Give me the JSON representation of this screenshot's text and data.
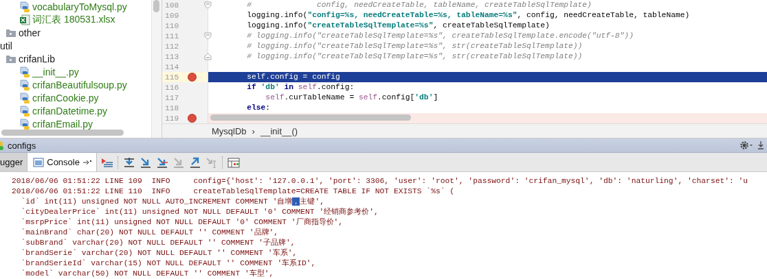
{
  "project_tree": {
    "items": [
      {
        "children": [
          {
            "children": [
              {
                "label": "vocabularyToMysql.py",
                "kind": "python"
              },
              {
                "label": "词汇表 180531.xlsx",
                "kind": "excel"
              }
            ]
          },
          {
            "label": "other",
            "kind": "folder"
          }
        ]
      },
      {
        "label": "util",
        "children": [
          {
            "label": "crifanLib",
            "kind": "folder",
            "children": [
              {
                "label": "__init__.py",
                "kind": "python"
              },
              {
                "label": "crifanBeautifulsoup.py",
                "kind": "python"
              },
              {
                "label": "crifanCookie.py",
                "kind": "python"
              },
              {
                "label": "crifanDatetime.py",
                "kind": "python"
              },
              {
                "label": "crifanEmail.py",
                "kind": "python"
              }
            ]
          }
        ]
      }
    ]
  },
  "editor": {
    "lines": [
      {
        "number": "108",
        "breakpoint": false,
        "current": false,
        "fold_start": true,
        "fold_end": false,
        "tokens": [
          {
            "text": "        #              config, needCreateTable, tableName, createTableSqlTemplate)",
            "kind": "comment"
          }
        ]
      },
      {
        "number": "109",
        "breakpoint": false,
        "current": false,
        "fold_start": false,
        "fold_end": false,
        "tokens": [
          {
            "text": "        logging.info(",
            "kind": "plain"
          },
          {
            "text": "\"config=%s, needCreateTable=%s, tableName=%s\"",
            "kind": "string"
          },
          {
            "text": ", config, needCreateTable, tableName)",
            "kind": "plain"
          }
        ]
      },
      {
        "number": "110",
        "breakpoint": false,
        "current": false,
        "fold_start": false,
        "fold_end": false,
        "tokens": [
          {
            "text": "        logging.info(",
            "kind": "plain"
          },
          {
            "text": "\"createTableSqlTemplate=%s\"",
            "kind": "string"
          },
          {
            "text": ", createTableSqlTemplate)",
            "kind": "plain"
          }
        ]
      },
      {
        "number": "111",
        "breakpoint": false,
        "current": false,
        "fold_start": true,
        "fold_end": false,
        "tokens": [
          {
            "text": "        # logging.info(\"createTableSqlTemplate=%s\", createTableSqlTemplate.encode(\"utf-8\"))",
            "kind": "comment"
          }
        ]
      },
      {
        "number": "112",
        "breakpoint": false,
        "current": false,
        "fold_start": false,
        "fold_end": false,
        "tokens": [
          {
            "text": "        # logging.info(\"createTableSqlTemplate=%s\", str(createTableSqlTemplate))",
            "kind": "comment"
          }
        ]
      },
      {
        "number": "113",
        "breakpoint": false,
        "current": false,
        "fold_start": false,
        "fold_end": true,
        "tokens": [
          {
            "text": "        # logging.info(\"createTableSqlTemplate=%s\", str(createTableSqlTemplate))",
            "kind": "comment"
          }
        ]
      },
      {
        "number": "114",
        "breakpoint": false,
        "current": false,
        "fold_start": false,
        "fold_end": false
      },
      {
        "number": "115",
        "breakpoint": true,
        "current": true,
        "fold_start": false,
        "fold_end": false,
        "tokens": [
          {
            "text": "        self",
            "kind": "self"
          },
          {
            "text": ".config = config",
            "kind": "plain"
          }
        ]
      },
      {
        "number": "116",
        "breakpoint": false,
        "current": false,
        "fold_start": false,
        "fold_end": false,
        "tokens": [
          {
            "text": "        if",
            "kind": "keyword"
          },
          {
            "text": " 'db'",
            "kind": "string"
          },
          {
            "text": " in",
            "kind": "keyword"
          },
          {
            "text": " self",
            "kind": "self"
          },
          {
            "text": ".config:",
            "kind": "plain"
          }
        ]
      },
      {
        "number": "117",
        "breakpoint": false,
        "current": false,
        "fold_start": false,
        "fold_end": false,
        "tokens": [
          {
            "text": "            self",
            "kind": "self"
          },
          {
            "text": ".curTableName = ",
            "kind": "plain"
          },
          {
            "text": "self",
            "kind": "self"
          },
          {
            "text": ".config[",
            "kind": "plain"
          },
          {
            "text": "'db'",
            "kind": "string"
          },
          {
            "text": "]",
            "kind": "plain"
          }
        ]
      },
      {
        "number": "118",
        "breakpoint": false,
        "current": false,
        "fold_start": false,
        "fold_end": false,
        "tokens": [
          {
            "text": "        else",
            "kind": "keyword"
          },
          {
            "text": ":",
            "kind": "plain"
          }
        ]
      },
      {
        "number": "119",
        "breakpoint": true,
        "current": false,
        "fold_start": false,
        "fold_end": false
      }
    ]
  },
  "breadcrumb": {
    "items": [
      "MysqlDb",
      "__init__()"
    ],
    "separator": "›"
  },
  "tool_window": {
    "title": "configs"
  },
  "tabs": [
    {
      "label": "ugger",
      "selected": false
    },
    {
      "label": "Console",
      "selected": true
    }
  ],
  "console": {
    "lines": [
      {
        "segments": [
          {
            "text": "2018/06/06 01:51:22 LINE 109  INFO     config={'host': '127.0.0.1', 'port': 3306, 'user': 'root', 'password': 'crifan_mysql', 'db': 'naturling', 'charset': 'u",
            "selected": false
          }
        ]
      },
      {
        "segments": [
          {
            "text": "2018/06/06 01:51:22 LINE 110  INFO     createTableSqlTemplate=CREATE TABLE IF NOT EXISTS `%s` (",
            "selected": false
          }
        ]
      },
      {
        "segments": [
          {
            "text": "  `id` int(11) unsigned NOT NULL AUTO_INCREMENT COMMENT '自增",
            "selected": false
          },
          {
            "text": "，",
            "selected": true
          },
          {
            "text": "主键',",
            "selected": false
          }
        ]
      },
      {
        "segments": [
          {
            "text": "  `cityDealerPrice` int(11) unsigned NOT NULL DEFAULT '0' COMMENT '经销商参考价',",
            "selected": false
          }
        ]
      },
      {
        "segments": [
          {
            "text": "  `msrpPrice` int(11) unsigned NOT NULL DEFAULT '0' COMMENT '厂商指导价',",
            "selected": false
          }
        ]
      },
      {
        "segments": [
          {
            "text": "  `mainBrand` char(20) NOT NULL DEFAULT '' COMMENT '品牌',",
            "selected": false
          }
        ]
      },
      {
        "segments": [
          {
            "text": "  `subBrand` varchar(20) NOT NULL DEFAULT '' COMMENT '子品牌',",
            "selected": false
          }
        ]
      },
      {
        "segments": [
          {
            "text": "  `brandSerie` varchar(20) NOT NULL DEFAULT '' COMMENT '车系',",
            "selected": false
          }
        ]
      },
      {
        "segments": [
          {
            "text": "  `brandSerieId` varchar(15) NOT NULL DEFAULT '' COMMENT '车系ID',",
            "selected": false
          }
        ]
      },
      {
        "segments": [
          {
            "text": "  `model` varchar(50) NOT NULL DEFAULT '' COMMENT '车型',",
            "selected": false
          }
        ]
      }
    ]
  }
}
